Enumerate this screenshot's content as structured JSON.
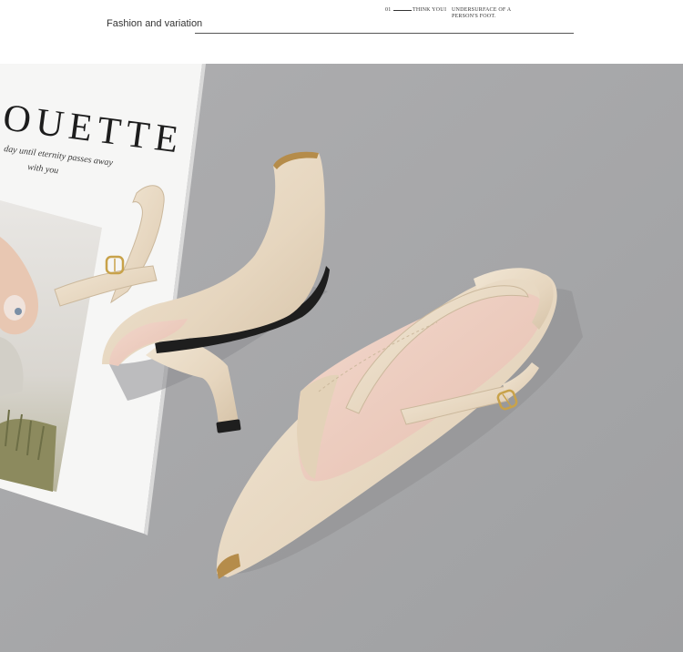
{
  "header": {
    "title": "Fashion and variation",
    "number": "01",
    "think": "THINK YOU",
    "separator": "I",
    "underside": "UNDERSURFACE OF A PERSON'S FOOT."
  },
  "magazine": {
    "headline": "OUETTE",
    "script_line1": "day until eternity passes away",
    "script_line2": "with you"
  },
  "colors": {
    "background": "#a7a7a9",
    "shoe": "#e9dcc8",
    "lining": "#efcfc3",
    "sole": "#1e1e1e",
    "buckle": "#c8a24a"
  }
}
